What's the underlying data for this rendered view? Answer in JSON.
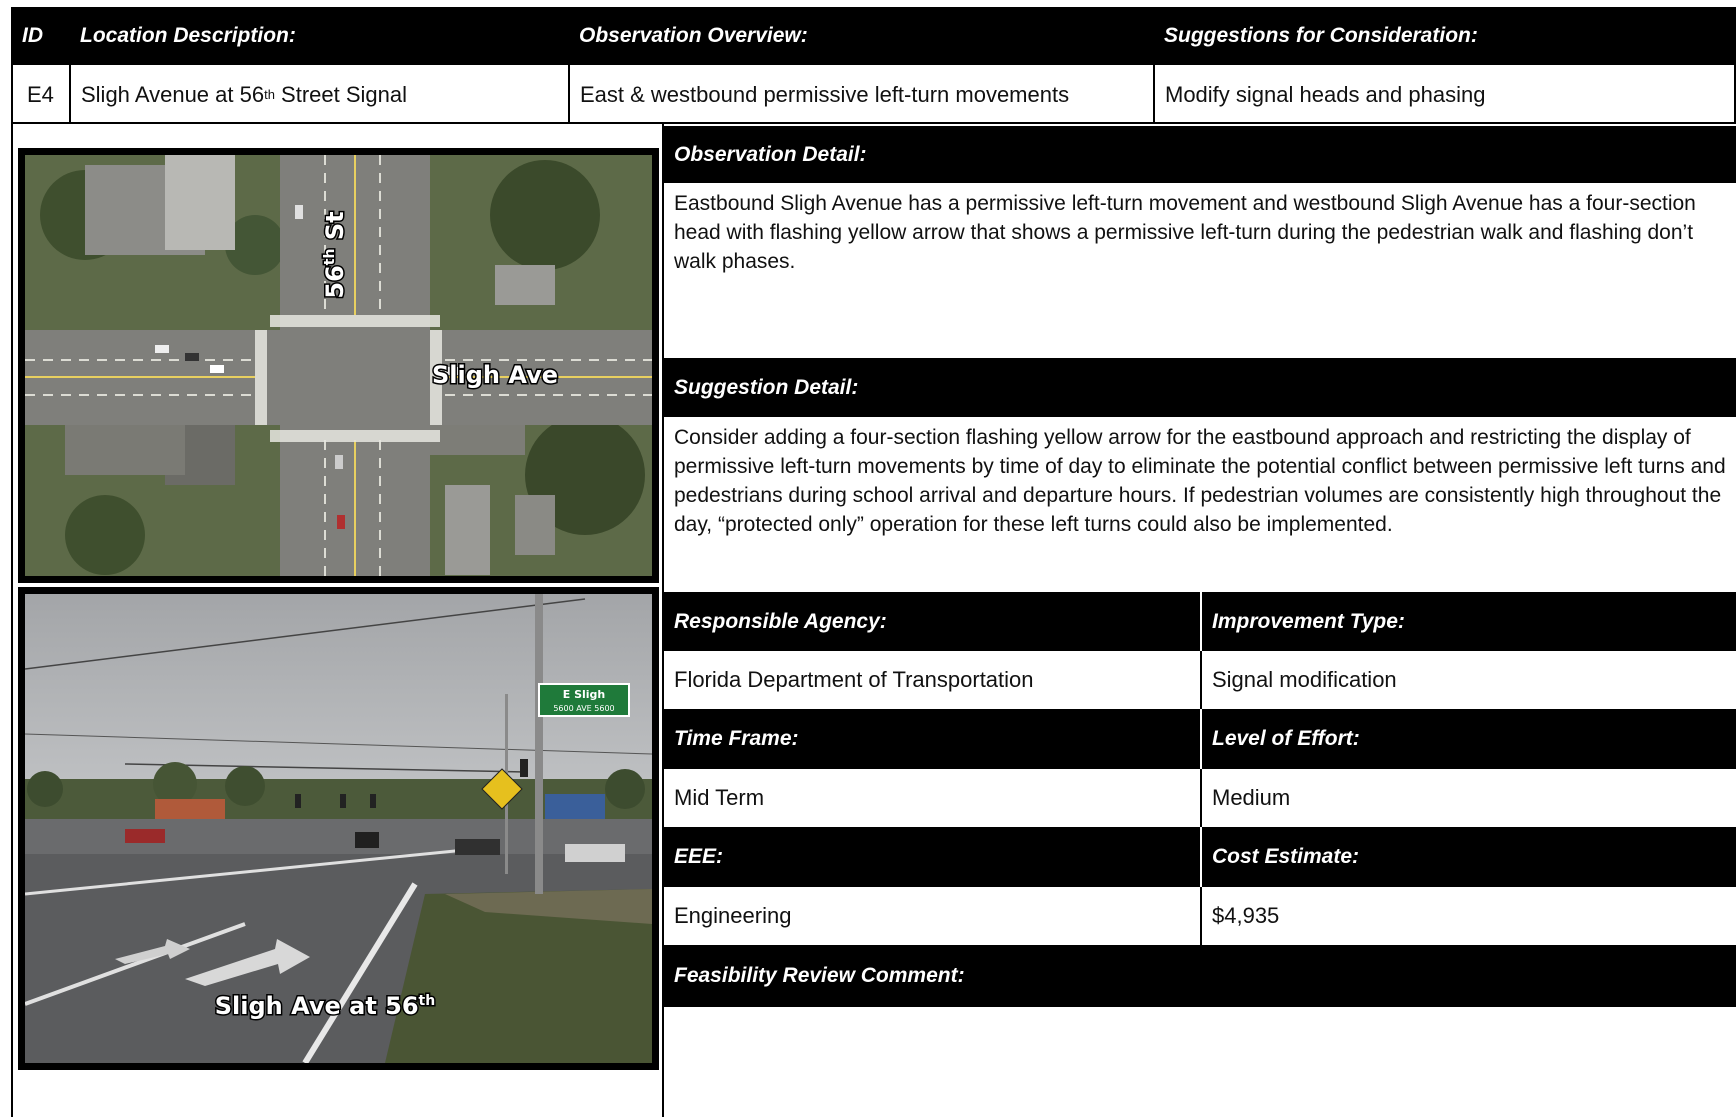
{
  "header": {
    "id_label": "ID",
    "location_label": "Location Description:",
    "observation_label": "Observation Overview:",
    "suggestions_label": "Suggestions for Consideration:"
  },
  "row": {
    "id": "E4",
    "location_pre": "Sligh Avenue at 56",
    "location_sup": "th",
    "location_post": " Street Signal",
    "observation": "East & westbound permissive left-turn movements",
    "suggestion": "Modify signal heads and phasing"
  },
  "aerial": {
    "street_label_num": "56",
    "street_label_sup": "th",
    "street_label_post": " St",
    "avenue_label": "Sligh Ave"
  },
  "street_photo": {
    "sign_line1": "E Sligh",
    "sign_line2": "5600  AVE  5600",
    "caption_pre": "Sligh Ave at 56",
    "caption_sup": "th"
  },
  "observation_detail": {
    "label": "Observation Detail:",
    "text": "Eastbound Sligh Avenue has a permissive left-turn movement and westbound Sligh Avenue has a four-section head with flashing yellow arrow that shows a permissive left-turn during the pedestrian walk and flashing don’t walk phases."
  },
  "suggestion_detail": {
    "label": "Suggestion Detail:",
    "text": "Consider adding a four-section flashing yellow arrow for the eastbound approach and restricting the display of permissive left-turn movements by time of day to eliminate the potential conflict between permissive left turns and pedestrians during school arrival and departure hours. If pedestrian volumes are consistently high throughout the day, “protected only” operation for these left turns could also be implemented."
  },
  "details": {
    "agency_label": "Responsible Agency:",
    "agency_value": "Florida Department of Transportation",
    "improvement_label": "Improvement Type:",
    "improvement_value": "Signal modification",
    "timeframe_label": "Time Frame:",
    "timeframe_value": "Mid Term",
    "effort_label": "Level of Effort:",
    "effort_value": "Medium",
    "eee_label": "EEE:",
    "eee_value": "Engineering",
    "cost_label": "Cost Estimate:",
    "cost_value": "$4,935",
    "feasibility_label": "Feasibility Review Comment:"
  }
}
